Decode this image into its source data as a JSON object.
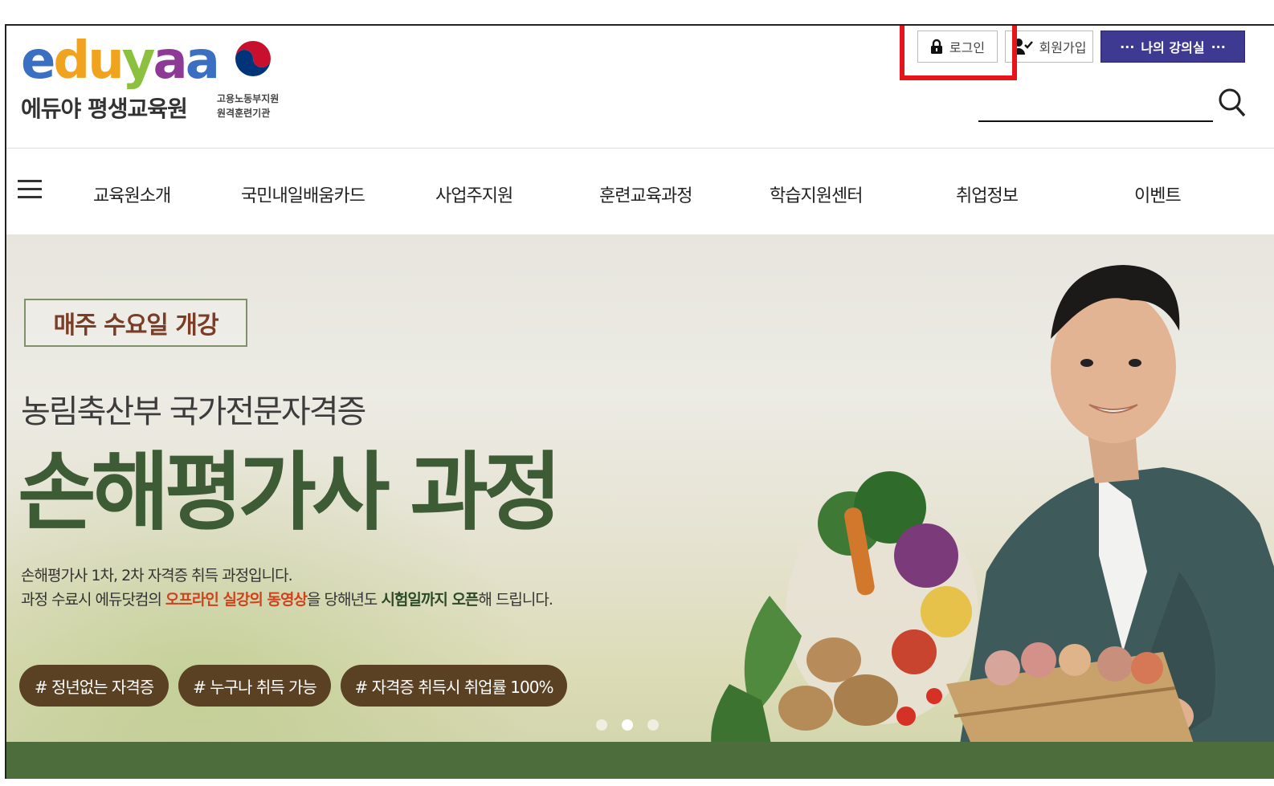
{
  "logo": {
    "word": [
      "e",
      "d",
      "u",
      "y",
      "a",
      "a"
    ],
    "word_colors": [
      "#3b6fc1",
      "#f0a31e",
      "#f0a31e",
      "#8bc13f",
      "#8d3a96",
      "#3b6fc1"
    ],
    "subtitle": "에듀야 평생교육원"
  },
  "gov": {
    "line1": "고용노동부지원",
    "line2": "원격훈련기관"
  },
  "top_buttons": {
    "login": "로그인",
    "join": "회원가입",
    "my_class": "나의 강의실",
    "my_class_dots": "···"
  },
  "search": {
    "placeholder": ""
  },
  "nav": {
    "items": [
      "교육원소개",
      "국민내일배움카드",
      "사업주지원",
      "훈련교육과정",
      "학습지원센터",
      "취업정보",
      "이벤트"
    ]
  },
  "hero": {
    "badge": "매주 수요일 개강",
    "subtitle": "농림축산부 국가전문자격증",
    "title": "손해평가사 과정",
    "desc_line1": "손해평가사 1차, 2차 자격증 취득 과정입니다.",
    "desc_line2": {
      "a": "과정 수료시 에듀닷컴의 ",
      "b": "오프라인 실강의 동영상",
      "c": "을 당해년도 ",
      "d": "시험일까지 오픈",
      "e": "해 드립니다."
    },
    "tags": [
      "# 정년없는 자격증",
      "# 누구나 취득 가능",
      "# 자격증 취득시 취업률 100%"
    ],
    "slides": 3,
    "active_slide": 2
  },
  "colors": {
    "highlight": "#e8141c",
    "brand_purple": "#3f3a91",
    "hero_green": "#3d5c35",
    "tag_brown": "#5b4124"
  }
}
